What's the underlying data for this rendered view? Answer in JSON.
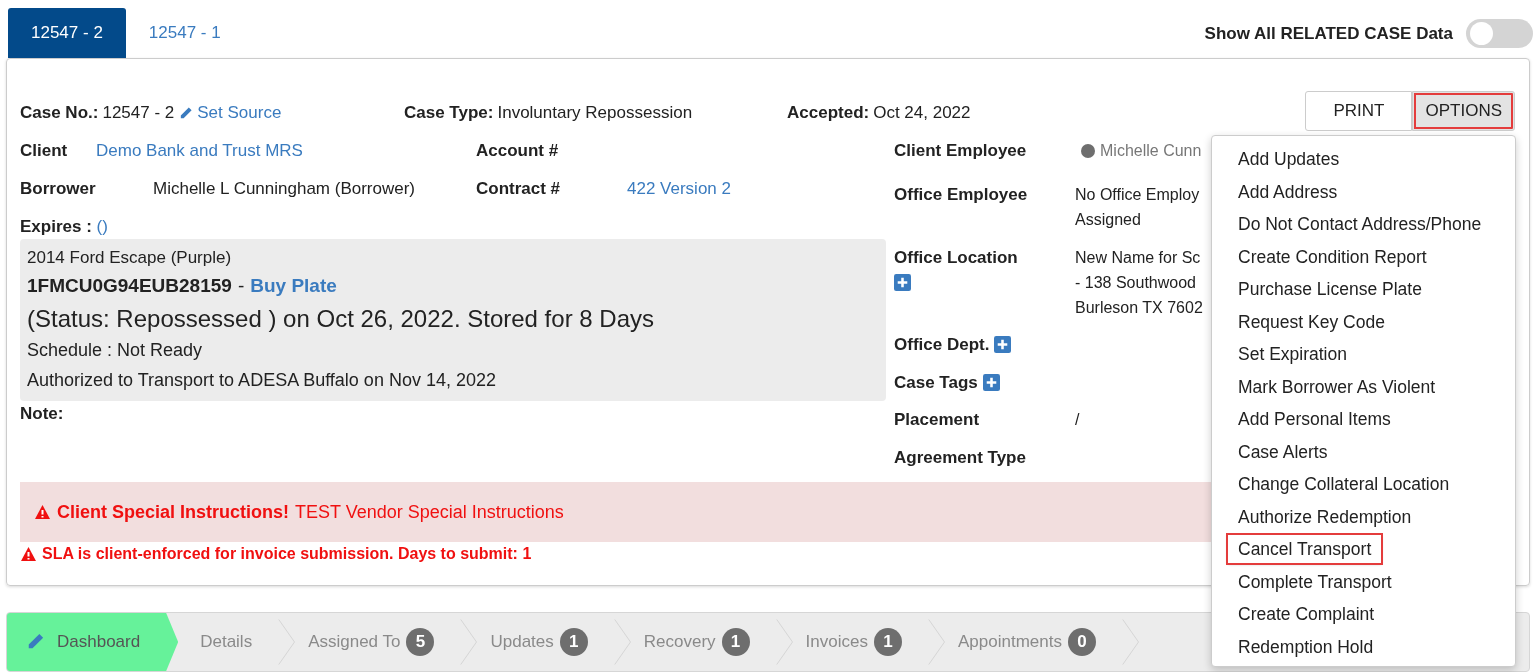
{
  "tabs": [
    {
      "label": "12547 - 2",
      "selected": true
    },
    {
      "label": "12547 - 1",
      "selected": false
    }
  ],
  "related_toggle": {
    "label": "Show All RELATED CASE Data",
    "on": false
  },
  "header_fields": [
    {
      "label": "Case No.:",
      "value": "12547 - 2",
      "link": "Set Source"
    },
    {
      "label": "Case Type:",
      "value": "Involuntary Repossession"
    },
    {
      "label": "Accepted:",
      "value": "Oct 24, 2022"
    }
  ],
  "actions": [
    {
      "label": "PRINT",
      "highlighted": false
    },
    {
      "label": "OPTIONS",
      "highlighted": true
    }
  ],
  "left_rows": [
    [
      {
        "label": "Client",
        "value": "Demo Bank and Trust MRS",
        "kind": "link"
      },
      {
        "label": "Account #"
      }
    ],
    [
      {
        "label": "Borrower",
        "value": "Michelle L Cunningham (Borrower)",
        "kind": "text"
      },
      {
        "label": "Contract #",
        "value": "422 Version 2",
        "kind": "link"
      }
    ]
  ],
  "expires": {
    "label": "Expires :",
    "value": "()"
  },
  "vehicle": {
    "description": "2014 Ford Escape (Purple)",
    "vin": "1FMCU0G94EUB28159",
    "separator": "-",
    "plate_link": "Buy Plate",
    "status": "(Status: Repossessed ) on Oct 26, 2022. Stored for 8 Days",
    "schedule": "Schedule : Not Ready",
    "transport": "Authorized to Transport to ADESA Buffalo on Nov 14, 2022"
  },
  "note": {
    "label": "Note:"
  },
  "right_fields": [
    {
      "label": "Client Employee",
      "kind": "person",
      "lines": [
        "Michelle Cunn"
      ]
    },
    {
      "label": "Office Employee",
      "kind": "text",
      "lines": [
        "No Office Employ",
        "Assigned"
      ]
    },
    {
      "label": "Office Location",
      "kind": "add_below",
      "lines": [
        "New Name for Sc",
        "- 138 Southwood",
        "Burleson TX 7602"
      ]
    },
    {
      "label": "Office Dept.",
      "kind": "add_inline"
    },
    {
      "label": "Case Tags",
      "kind": "add_inline"
    },
    {
      "label": "Placement",
      "kind": "text",
      "lines": [
        "/"
      ]
    },
    {
      "label": "Agreement Type",
      "kind": "text"
    }
  ],
  "special_instructions": {
    "title": "Client Special Instructions!",
    "text": "TEST Vendor Special Instructions"
  },
  "sla_warning": "SLA is client-enforced for invoice submission. Days to submit: 1",
  "options_menu": [
    {
      "label": "Add Updates",
      "highlighted": false
    },
    {
      "label": "Add Address",
      "highlighted": false
    },
    {
      "label": "Do Not Contact Address/Phone",
      "highlighted": false
    },
    {
      "label": "Create Condition Report",
      "highlighted": false
    },
    {
      "label": "Purchase License Plate",
      "highlighted": false
    },
    {
      "label": "Request Key Code",
      "highlighted": false
    },
    {
      "label": "Set Expiration",
      "highlighted": false
    },
    {
      "label": "Mark Borrower As Violent",
      "highlighted": false
    },
    {
      "label": "Add Personal Items",
      "highlighted": false
    },
    {
      "label": "Case Alerts",
      "highlighted": false
    },
    {
      "label": "Change Collateral Location",
      "highlighted": false
    },
    {
      "label": "Authorize Redemption",
      "highlighted": false
    },
    {
      "label": "Cancel Transport",
      "highlighted": true
    },
    {
      "label": "Complete Transport",
      "highlighted": false
    },
    {
      "label": "Create Complaint",
      "highlighted": false
    },
    {
      "label": "Redemption Hold",
      "highlighted": false
    }
  ],
  "steps": [
    {
      "label": "Dashboard",
      "selected": true
    },
    {
      "label": "Details",
      "selected": false
    },
    {
      "label": "Assigned To",
      "selected": false,
      "count": "5"
    },
    {
      "label": "Updates",
      "selected": false,
      "count": "1"
    },
    {
      "label": "Recovery",
      "selected": false,
      "count": "1"
    },
    {
      "label": "Invoices",
      "selected": false,
      "count": "1"
    },
    {
      "label": "Appointments",
      "selected": false,
      "count": "0"
    }
  ]
}
